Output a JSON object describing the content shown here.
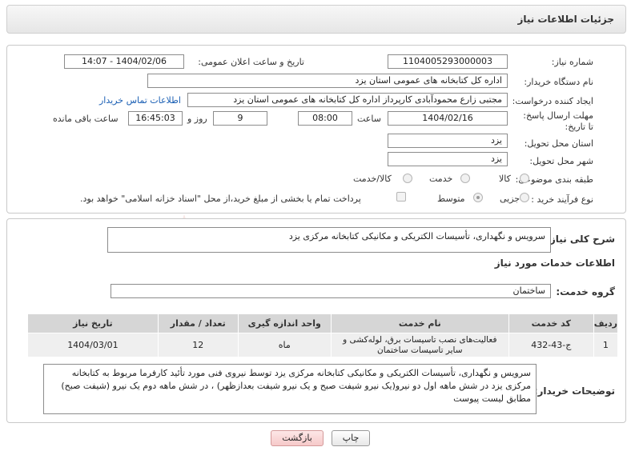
{
  "header": {
    "title": "جزئیات اطلاعات نیاز"
  },
  "form": {
    "need_number_label": "شماره نیاز:",
    "need_number": "1104005293000003",
    "announce_label": "تاریخ و ساعت اعلان عمومی:",
    "announce_value": "1404/02/06 - 14:07",
    "buyer_org_label": "نام دستگاه خریدار:",
    "buyer_org": "اداره کل کتابخانه های عمومی استان یزد",
    "requester_label": "ایجاد کننده درخواست:",
    "requester": "مجتبی زارع محمودآبادی کارپرداز اداره کل کتابخانه های عمومی استان یزد",
    "contact_link": "اطلاعات تماس خریدار",
    "deadline_label": "مهلت ارسال پاسخ: تا تاریخ:",
    "deadline_date": "1404/02/16",
    "time_label": "ساعت",
    "deadline_time": "08:00",
    "days_value": "9",
    "days_label": "روز و",
    "remaining_time": "16:45:03",
    "remaining_label": "ساعت باقی مانده",
    "province_label": "استان محل تحویل:",
    "province": "یزد",
    "city_label": "شهر محل تحویل:",
    "city": "یزد",
    "category_label": "طبقه بندی موضوعی:",
    "category_options": [
      "کالا",
      "خدمت",
      "کالا/خدمت"
    ],
    "category_selected": "خدمت",
    "process_label": "نوع فرآیند خرید :",
    "process_options": [
      "جزیی",
      "متوسط"
    ],
    "process_selected": "متوسط",
    "payment_note": "پرداخت تمام یا بخشی از مبلغ خرید،از محل \"اسناد خزانه اسلامی\" خواهد بود."
  },
  "summary": {
    "label": "شرح کلی نیاز:",
    "value": "سرویس و نگهداری، تأسیسات الکتریکی و مکانیکی کتابخانه مرکزی یزد"
  },
  "services": {
    "section_title": "اطلاعات خدمات مورد نیاز",
    "group_label": "گروه خدمت:",
    "group_value": "ساختمان",
    "columns": [
      "ردیف",
      "کد خدمت",
      "نام خدمت",
      "واحد اندازه گیری",
      "تعداد / مقدار",
      "تاریخ نیاز"
    ],
    "rows": [
      {
        "row": "1",
        "code": "ج-43-432",
        "name": "فعالیت‌های نصب تاسیسات برق، لوله‌کشی و سایر تاسیسات ساختمان",
        "unit": "ماه",
        "qty": "12",
        "date": "1404/03/01"
      }
    ]
  },
  "buyer_notes": {
    "label": "توضیحات خریدار:",
    "value": "سرویس و نگهداری، تأسیسات الکتریکی و مکانیکی کتابخانه مرکزی یزد توسط نیروی فنی مورد تأئید کارفرما مربوط به کتابخانه مرکزی یزد در شش ماهه اول دو نیرو(یک نیرو شیفت صبح و یک نیرو شیفت بعدازظهر) ، در شش ماهه دوم یک نیرو (شیفت صبح) مطابق لیست پیوست"
  },
  "buttons": {
    "print": "چاپ",
    "back": "بازگشت"
  },
  "watermark": {
    "text": "AriaTender.neT"
  }
}
